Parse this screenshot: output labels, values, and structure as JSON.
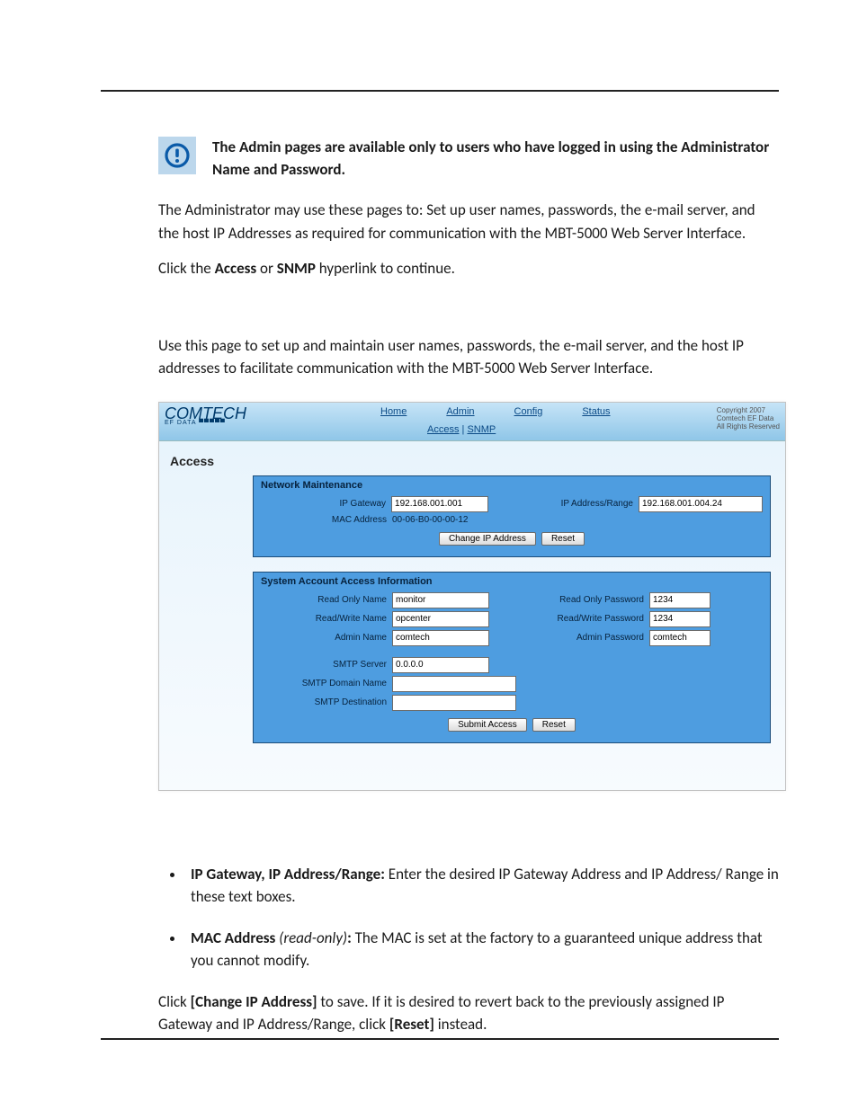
{
  "note_text": "The Admin pages are available only to users who have logged in using the Administrator Name and Password.",
  "para1": "The Administrator may use these pages to: Set up user names, passwords, the e-mail server, and the host IP Addresses as required for communication with the MBT-5000 Web Server Interface.",
  "para2_pre": "Click the ",
  "para2_b1": "Access",
  "para2_mid": " or ",
  "para2_b2": "SNMP",
  "para2_post": " hyperlink to continue.",
  "para3": "Use this page to set up and maintain user names, passwords, the e-mail server, and the host IP addresses to facilitate communication with the MBT-5000 Web Server Interface.",
  "ss": {
    "logo_main": "COMTECH",
    "logo_sub": "EF DATA ▀▀▀▀▀",
    "tabs": {
      "home": "Home",
      "admin": "Admin",
      "config": "Config",
      "status": "Status"
    },
    "subtabs": {
      "access": "Access",
      "sep": " | ",
      "snmp": "SNMP"
    },
    "copy1": "Copyright 2007",
    "copy2": "Comtech EF Data",
    "copy3": "All Rights Reserved",
    "title": "Access",
    "panel1": {
      "head": "Network Maintenance",
      "ip_gateway_lbl": "IP Gateway",
      "ip_gateway_val": "192.168.001.001",
      "ip_addr_lbl": "IP Address/Range",
      "ip_addr_val": "192.168.001.004.24",
      "mac_lbl": "MAC Address",
      "mac_val": "00-06-B0-00-00-12",
      "btn_change": "Change IP Address",
      "btn_reset": "Reset"
    },
    "panel2": {
      "head": "System Account Access Information",
      "ro_name_lbl": "Read Only Name",
      "ro_name_val": "monitor",
      "ro_pw_lbl": "Read Only Password",
      "ro_pw_val": "1234",
      "rw_name_lbl": "Read/Write Name",
      "rw_name_val": "opcenter",
      "rw_pw_lbl": "Read/Write Password",
      "rw_pw_val": "1234",
      "admin_name_lbl": "Admin Name",
      "admin_name_val": "comtech",
      "admin_pw_lbl": "Admin Password",
      "admin_pw_val": "comtech",
      "smtp_srv_lbl": "SMTP Server",
      "smtp_srv_val": "0.0.0.0",
      "smtp_dom_lbl": "SMTP Domain Name",
      "smtp_dom_val": "",
      "smtp_dst_lbl": "SMTP Destination",
      "smtp_dst_val": "",
      "btn_submit": "Submit Access",
      "btn_reset": "Reset"
    }
  },
  "bullet1_b": "IP Gateway, IP Address/Range:",
  "bullet1_t": " Enter the desired IP Gateway Address and IP Address/ Range in these text boxes.",
  "bullet2_b": "MAC Address ",
  "bullet2_i": "(read-only)",
  "bullet2_t": " The MAC is set at the factory to a guaranteed unique address that you cannot modify.",
  "para4_pre": "Click ",
  "para4_b1": "[Change IP Address]",
  "para4_mid": " to save. If it is desired to revert back to the previously assigned IP Gateway and IP Address/Range, click ",
  "para4_b2": "[Reset]",
  "para4_post": " instead."
}
